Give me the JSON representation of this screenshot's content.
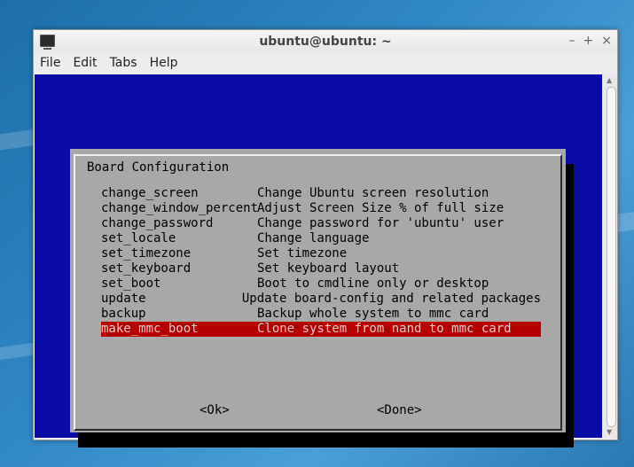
{
  "window": {
    "title": "ubuntu@ubuntu: ~",
    "controls": [
      "–",
      "+",
      "×"
    ],
    "app_icon": "terminal-icon"
  },
  "menubar": {
    "items": [
      "File",
      "Edit",
      "Tabs",
      "Help"
    ]
  },
  "dialog": {
    "title": "Board Configuration",
    "items": [
      {
        "tag": "change_screen",
        "desc": "Change Ubuntu screen resolution"
      },
      {
        "tag": "change_window_percent",
        "desc": "Adjust Screen Size % of full size"
      },
      {
        "tag": "change_password",
        "desc": "Change password for 'ubuntu' user"
      },
      {
        "tag": "set_locale",
        "desc": "Change language"
      },
      {
        "tag": "set_timezone",
        "desc": "Set timezone"
      },
      {
        "tag": "set_keyboard",
        "desc": "Set keyboard layout"
      },
      {
        "tag": "set_boot",
        "desc": "Boot to cmdline only or desktop"
      },
      {
        "tag": "update",
        "desc": "Update board-config and related packages"
      },
      {
        "tag": "backup",
        "desc": "Backup whole system to mmc card"
      },
      {
        "tag": "make_mmc_boot",
        "desc": "Clone system from nand to mmc card"
      }
    ],
    "selected_index": 9,
    "ok_button": "<Ok>",
    "done_button": "<Done>"
  },
  "colors": {
    "terminal_bg": "#0b0ba5",
    "dialog_bg": "#a8a8a8",
    "selection": "#b40000"
  }
}
